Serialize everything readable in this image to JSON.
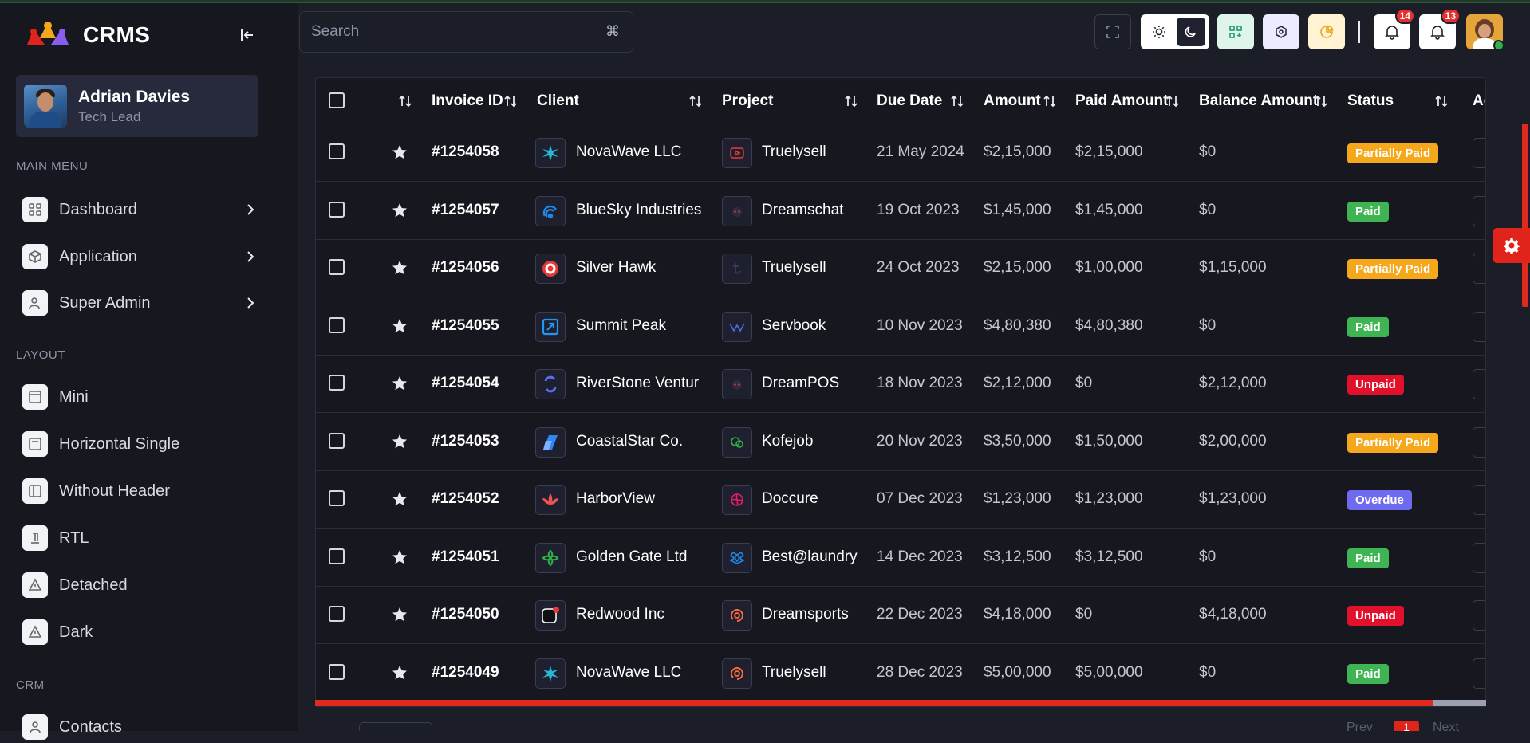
{
  "app": {
    "name": "CRMS"
  },
  "user": {
    "name": "Adrian Davies",
    "role": "Tech Lead"
  },
  "sidebar": {
    "sections": [
      {
        "label": "MAIN MENU",
        "items": [
          {
            "label": "Dashboard",
            "icon": "grid-icon",
            "has_children": true
          },
          {
            "label": "Application",
            "icon": "cube-icon",
            "has_children": true
          },
          {
            "label": "Super Admin",
            "icon": "user-cog-icon",
            "has_children": true
          }
        ]
      },
      {
        "label": "LAYOUT",
        "items": [
          {
            "label": "Mini",
            "icon": "layout-icon"
          },
          {
            "label": "Horizontal Single",
            "icon": "layout-icon"
          },
          {
            "label": "Without Header",
            "icon": "layout-sidebar-icon"
          },
          {
            "label": "RTL",
            "icon": "text-direction-icon"
          },
          {
            "label": "Detached",
            "icon": "alert-triangle-icon"
          },
          {
            "label": "Dark",
            "icon": "alert-triangle-icon"
          }
        ]
      },
      {
        "label": "CRM",
        "items": [
          {
            "label": "Contacts",
            "icon": "user-icon"
          }
        ]
      }
    ]
  },
  "header": {
    "search_placeholder": "Search",
    "search_shortcut": "⌘",
    "message_badge": "14",
    "notification_badge": "13"
  },
  "table": {
    "columns": [
      "Invoice ID",
      "Client",
      "Project",
      "Due Date",
      "Amount",
      "Paid Amount",
      "Balance Amount",
      "Status",
      "Ac"
    ],
    "rows": [
      {
        "id": "#1254058",
        "client": "NovaWave LLC",
        "client_logo": "novawave",
        "project": "Truelysell",
        "project_logo": "youtube",
        "due": "21 May 2024",
        "amount": "$2,15,000",
        "paid": "$2,15,000",
        "balance": "$0",
        "status": "Partially Paid",
        "status_class": "st-partial"
      },
      {
        "id": "#1254057",
        "client": "BlueSky Industries",
        "client_logo": "bluesky",
        "project": "Dreamschat",
        "project_logo": "dreamschat",
        "due": "19 Oct 2023",
        "amount": "$1,45,000",
        "paid": "$1,45,000",
        "balance": "$0",
        "status": "Paid",
        "status_class": "st-paid"
      },
      {
        "id": "#1254056",
        "client": "Silver Hawk",
        "client_logo": "silverhawk",
        "project": "Truelysell",
        "project_logo": "truelysell",
        "due": "24 Oct 2023",
        "amount": "$2,15,000",
        "paid": "$1,00,000",
        "balance": "$1,15,000",
        "status": "Partially Paid",
        "status_class": "st-partial"
      },
      {
        "id": "#1254055",
        "client": "Summit Peak",
        "client_logo": "summit",
        "project": "Servbook",
        "project_logo": "servbook",
        "due": "10 Nov 2023",
        "amount": "$4,80,380",
        "paid": "$4,80,380",
        "balance": "$0",
        "status": "Paid",
        "status_class": "st-paid"
      },
      {
        "id": "#1254054",
        "client": "RiverStone Ventur",
        "client_logo": "riverstone",
        "project": "DreamPOS",
        "project_logo": "dreamschat",
        "due": "18 Nov 2023",
        "amount": "$2,12,000",
        "paid": "$0",
        "balance": "$2,12,000",
        "status": "Unpaid",
        "status_class": "st-unpaid"
      },
      {
        "id": "#1254053",
        "client": "CoastalStar Co.",
        "client_logo": "coastal",
        "project": "Kofejob",
        "project_logo": "kofejob",
        "due": "20 Nov 2023",
        "amount": "$3,50,000",
        "paid": "$1,50,000",
        "balance": "$2,00,000",
        "status": "Partially Paid",
        "status_class": "st-partial"
      },
      {
        "id": "#1254052",
        "client": "HarborView",
        "client_logo": "harbor",
        "project": "Doccure",
        "project_logo": "doccure",
        "due": "07 Dec 2023",
        "amount": "$1,23,000",
        "paid": "$1,23,000",
        "balance": "$1,23,000",
        "status": "Overdue",
        "status_class": "st-overdue"
      },
      {
        "id": "#1254051",
        "client": "Golden Gate Ltd",
        "client_logo": "golden",
        "project": "Best@laundry",
        "project_logo": "laundry",
        "due": "14 Dec 2023",
        "amount": "$3,12,500",
        "paid": "$3,12,500",
        "balance": "$0",
        "status": "Paid",
        "status_class": "st-paid"
      },
      {
        "id": "#1254050",
        "client": "Redwood Inc",
        "client_logo": "redwood",
        "project": "Dreamsports",
        "project_logo": "dreamsports",
        "due": "22 Dec 2023",
        "amount": "$4,18,000",
        "paid": "$0",
        "balance": "$4,18,000",
        "status": "Unpaid",
        "status_class": "st-unpaid"
      },
      {
        "id": "#1254049",
        "client": "NovaWave LLC",
        "client_logo": "novawave",
        "project": "Truelysell",
        "project_logo": "dreamsports",
        "due": "28 Dec 2023",
        "amount": "$5,00,000",
        "paid": "$5,00,000",
        "balance": "$0",
        "status": "Paid",
        "status_class": "st-paid"
      }
    ]
  },
  "pager": {
    "prev": "Prev",
    "current": "1",
    "next": "Next"
  },
  "colors": {
    "accent": "#e0241b",
    "paid": "#3eb552",
    "partial": "#f5a81b",
    "unpaid": "#e1102b",
    "overdue": "#6e6bf0"
  }
}
